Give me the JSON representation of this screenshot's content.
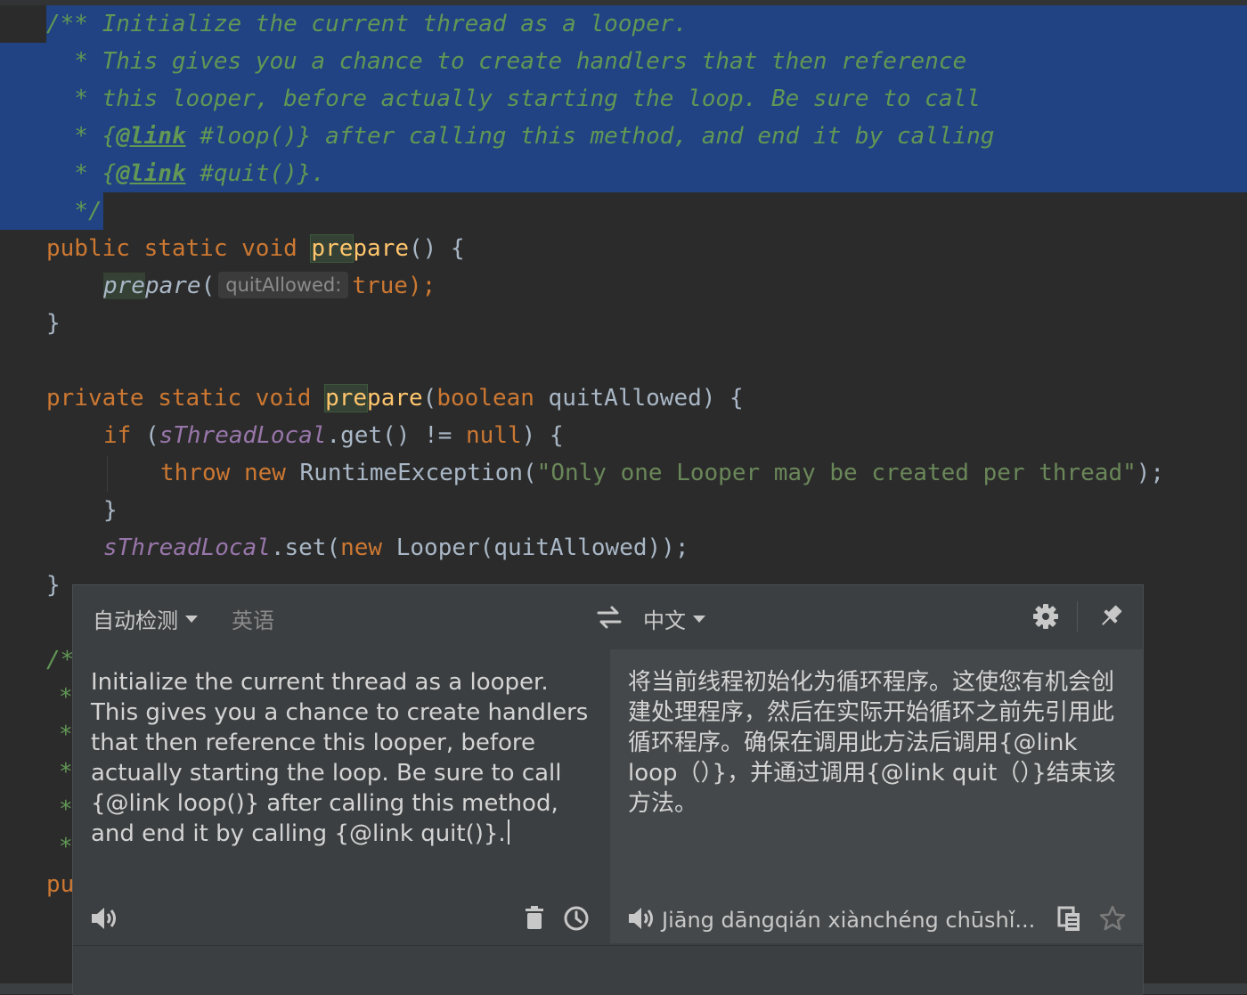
{
  "code": {
    "doc1": {
      "l1": "/** Initialize the current thread as a looper.",
      "l2": "  * This gives you a chance to create handlers that then reference",
      "l3": "  * this looper, before actually starting the loop. Be sure to call",
      "l4_pre": "  * {",
      "l4_tag": "@link",
      "l4_post": " #loop()} after calling this method, and end it by calling",
      "l5_pre": "  * {",
      "l5_tag": "@link",
      "l5_post": " #quit()}.",
      "l6": "  */"
    },
    "m1": {
      "kw": "public static void ",
      "name_hl": "pre",
      "name_rest": "pare",
      "sig_rest": "() {",
      "call_hl": "pre",
      "call_rest": "pare",
      "call_open": "(",
      "hint": "quitAllowed:",
      "arg": "true",
      "call_close": ");",
      "close": "}"
    },
    "m2": {
      "kw": "private static void ",
      "name_hl": "pre",
      "name_rest": "pare",
      "params_open": "(",
      "param_type": "boolean",
      "params_rest": " quitAllowed) {",
      "if_kw": "if",
      "if_open": " (",
      "field": "sThreadLocal",
      "get": ".get() != ",
      "null_kw": "null",
      "if_close": ") {",
      "throw_kw": "throw",
      "new_kw": "new",
      "exc": " RuntimeException(",
      "msg": "\"Only one Looper may be created per thread\"",
      "exc_close": ");",
      "brace": "}",
      "field2": "sThreadLocal",
      "set": ".set(",
      "new_kw2": "new",
      "looper": " Looper(quitAllowed));",
      "close": "}"
    },
    "partial": {
      "doc_start": "/*",
      "star": "*",
      "pu": "pu"
    }
  },
  "translator": {
    "source_lang": "自动检测",
    "detected_lang": "英语",
    "target_lang": "中文",
    "source_text": "Initialize the current thread as a looper. This gives you a chance to create handlers that then reference this looper, before actually starting the loop. Be sure to call {@link loop()} after calling this method, and end it by calling {@link quit()}.",
    "translated_text": "将当前线程初始化为循环程序。这使您有机会创建处理程序，然后在实际开始循环之前先引用此循环程序。确保在调用此方法后调用{@link loop（）}，并通过调用{@link quit（）}结束该方法。",
    "pinyin": "Jiāng dāngqián xiànchéng chūshǐ...",
    "icons": {
      "swap": "swap-icon",
      "settings": "gear-icon",
      "pin": "pin-icon",
      "speaker": "speaker-icon",
      "clear": "trash-icon",
      "history": "clock-icon",
      "copy": "copy-icon",
      "star": "star-icon"
    }
  },
  "colors": {
    "editor_bg": "#2b2b2b",
    "selection": "#214283",
    "doc_comment": "#629755",
    "keyword": "#cc7832",
    "string": "#6a8759",
    "field": "#9876aa",
    "method": "#ffc66d",
    "popup_bg": "#3c3f41"
  }
}
